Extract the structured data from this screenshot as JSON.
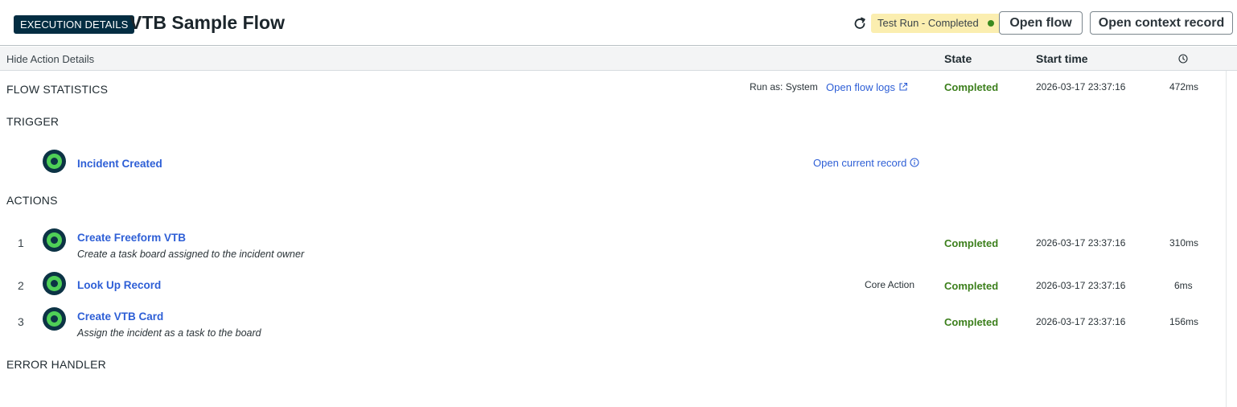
{
  "header": {
    "badge": "EXECUTION DETAILS",
    "title": "VTB Sample Flow",
    "status": "Test Run - Completed",
    "open_flow": "Open flow",
    "open_context": "Open context record"
  },
  "columns": {
    "hide_details": "Hide Action Details",
    "state": "State",
    "start_time": "Start time",
    "duration_icon": "clock-icon"
  },
  "flow_stats": {
    "title": "FLOW STATISTICS",
    "run_as": "Run as: System",
    "logs_link": "Open flow logs",
    "state": "Completed",
    "start": "2026-03-17 23:37:16",
    "duration": "472ms"
  },
  "trigger": {
    "title": "TRIGGER",
    "name": "Incident Created",
    "link": "Open current record"
  },
  "actions": {
    "title": "ACTIONS",
    "items": [
      {
        "num": "1",
        "name": "Create Freeform VTB",
        "desc": "Create a task board assigned to the incident owner",
        "state": "Completed",
        "start": "2026-03-17 23:37:16",
        "duration": "310ms"
      },
      {
        "num": "2",
        "name": "Look Up Record",
        "type": "Core Action",
        "state": "Completed",
        "start": "2026-03-17 23:37:16",
        "duration": "6ms"
      },
      {
        "num": "3",
        "name": "Create VTB Card",
        "desc": "Assign the incident as a task to the board",
        "state": "Completed",
        "start": "2026-03-17 23:37:16",
        "duration": "156ms"
      }
    ]
  },
  "error_handler": {
    "title": "ERROR HANDLER"
  },
  "colors": {
    "accent_link": "#2e5fd6",
    "success": "#3c7f1c",
    "badge_bg": "#032d42",
    "status_bg": "#fbeeb0",
    "icon_green": "#4fcf57"
  }
}
